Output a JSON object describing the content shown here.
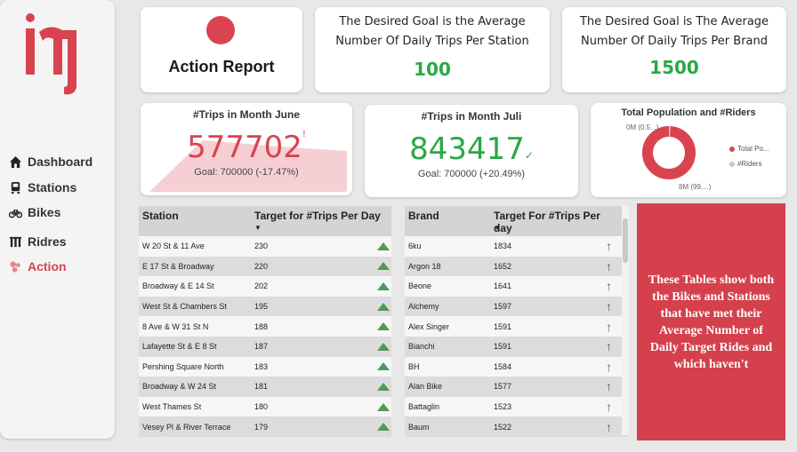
{
  "nav": [
    {
      "label": "Dashboard",
      "icon": "home-icon"
    },
    {
      "label": "Stations",
      "icon": "station-icon"
    },
    {
      "label": "Bikes",
      "icon": "bike-icon"
    },
    {
      "label": "Ridres",
      "icon": "riders-icon"
    },
    {
      "label": "Action",
      "icon": "action-icon"
    }
  ],
  "action_card": {
    "title": "Action Report"
  },
  "goal_station": {
    "text": "The Desired Goal is the Average Number Of Daily Trips Per Station",
    "value": "100"
  },
  "goal_brand": {
    "text": "The Desired Goal is The Average Number Of Daily Trips Per Brand",
    "value": "1500"
  },
  "kpi_june": {
    "title": "#Trips in Month June",
    "value": "577702",
    "indicator": "!",
    "goal": "Goal: 700000 (-17.47%)",
    "color": "#d9434f"
  },
  "kpi_july": {
    "title": "#Trips in Month Juli",
    "value": "843417",
    "indicator": "✓",
    "goal": "Goal: 700000 (+20.49%)",
    "color": "#2aa846"
  },
  "donut": {
    "title": "Total Population and #Riders",
    "label_top": "0M (0.5...)",
    "label_bottom": "8M (99....)",
    "legend": [
      {
        "name": "Total Po...",
        "color": "#d9434f"
      },
      {
        "name": "#Riders",
        "color": "#c8c8c8"
      }
    ]
  },
  "station_table": {
    "headers": [
      "Station",
      "Target for #Trips Per Day"
    ],
    "rows": [
      {
        "station": "W 20 St & 11 Ave",
        "target": "230"
      },
      {
        "station": "E 17 St & Broadway",
        "target": "220"
      },
      {
        "station": "Broadway & E 14 St",
        "target": "202"
      },
      {
        "station": "West St & Chambers St",
        "target": "195"
      },
      {
        "station": "8 Ave & W 31 St N",
        "target": "188"
      },
      {
        "station": "Lafayette St & E 8 St",
        "target": "187"
      },
      {
        "station": "Pershing Square North",
        "target": "183"
      },
      {
        "station": "Broadway & W 24 St",
        "target": "181"
      },
      {
        "station": "West Thames St",
        "target": "180"
      },
      {
        "station": "Vesey Pl & River Terrace",
        "target": "179"
      }
    ]
  },
  "brand_table": {
    "headers": [
      "Brand",
      "Target For #Trips Per day"
    ],
    "rows": [
      {
        "brand": "6ku",
        "target": "1834"
      },
      {
        "brand": "Argon 18",
        "target": "1652"
      },
      {
        "brand": "Beone",
        "target": "1641"
      },
      {
        "brand": "Alchemy",
        "target": "1597"
      },
      {
        "brand": "Alex Singer",
        "target": "1591"
      },
      {
        "brand": "Bianchi",
        "target": "1591"
      },
      {
        "brand": "BH",
        "target": "1584"
      },
      {
        "brand": "Alan Bike",
        "target": "1577"
      },
      {
        "brand": "Battaglin",
        "target": "1523"
      },
      {
        "brand": "Baum",
        "target": "1522"
      }
    ]
  },
  "note": {
    "text": "These Tables show both the Bikes and Stations that have met their Average Number of Daily Target Rides and which haven't"
  }
}
